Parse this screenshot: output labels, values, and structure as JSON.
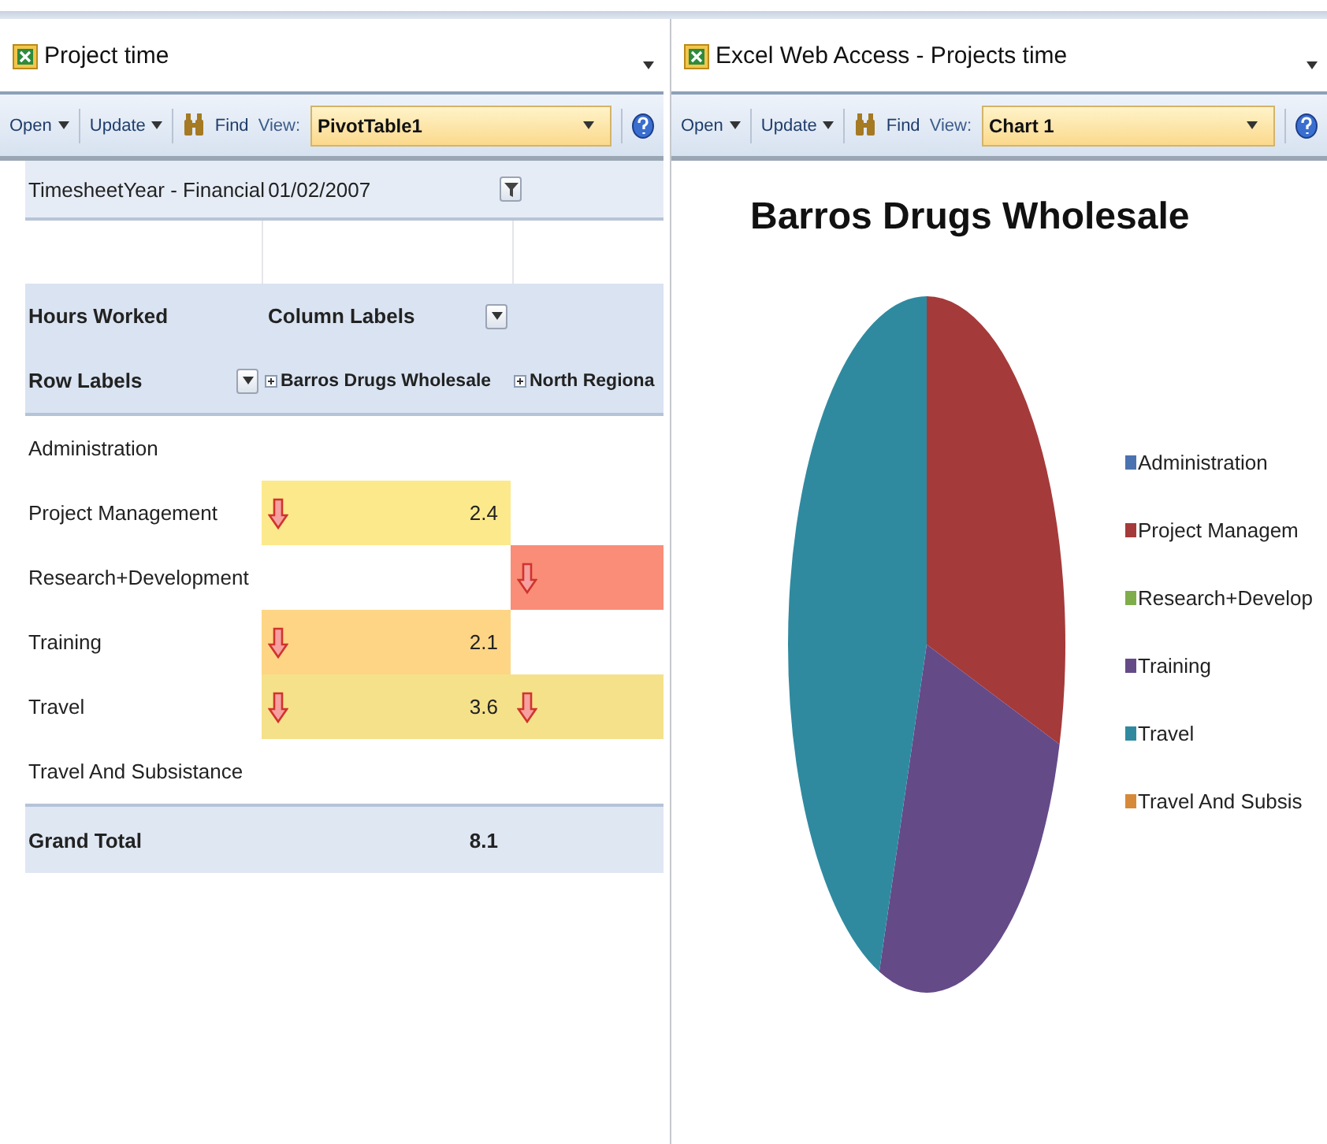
{
  "panels": [
    {
      "title": "Project time",
      "toolbar": {
        "open": "Open",
        "update": "Update",
        "find": "Find",
        "view_label": "View:",
        "view": "PivotTable1"
      }
    },
    {
      "title": "Excel Web Access - Projects time",
      "toolbar": {
        "open": "Open",
        "update": "Update",
        "find": "Find",
        "view_label": "View:",
        "view": "Chart 1"
      }
    }
  ],
  "pivot": {
    "filter_label": "TimesheetYear - Financial",
    "filter_value": "01/02/2007",
    "values_label": "Hours Worked",
    "column_labels": "Column Labels",
    "row_labels": "Row Labels",
    "columns": [
      "Barros Drugs Wholesale",
      "North Regiona"
    ],
    "rows": [
      {
        "label": "Administration",
        "cells": [
          {},
          {}
        ]
      },
      {
        "label": "Project Management",
        "cells": [
          {
            "value": "2.4",
            "color": "#fce98c",
            "down_arrow": true
          },
          {}
        ]
      },
      {
        "label": "Research+Development",
        "cells": [
          {},
          {
            "color": "#f98d78",
            "down_arrow": true
          }
        ]
      },
      {
        "label": "Training",
        "cells": [
          {
            "value": "2.1",
            "color": "#fdd585",
            "down_arrow": true
          },
          {}
        ]
      },
      {
        "label": "Travel",
        "cells": [
          {
            "value": "3.6",
            "color": "#f5e18a",
            "down_arrow": true
          },
          {
            "color": "#f5e18a",
            "down_arrow": true
          }
        ]
      },
      {
        "label": "Travel And Subsistance",
        "cells": [
          {},
          {}
        ]
      }
    ],
    "total_label": "Grand Total",
    "totals": [
      "8.1"
    ]
  },
  "chart": {
    "title": "Barros Drugs Wholesale",
    "legend": [
      {
        "label": "Administration",
        "color": "#4a72b0"
      },
      {
        "label": "Project Managem",
        "color": "#a53a3a"
      },
      {
        "label": "Research+Develop",
        "color": "#7fad4a"
      },
      {
        "label": "Training",
        "color": "#654a88"
      },
      {
        "label": "Travel",
        "color": "#2f8aa0"
      },
      {
        "label": "Travel And Subsis",
        "color": "#d7893a"
      }
    ]
  }
}
